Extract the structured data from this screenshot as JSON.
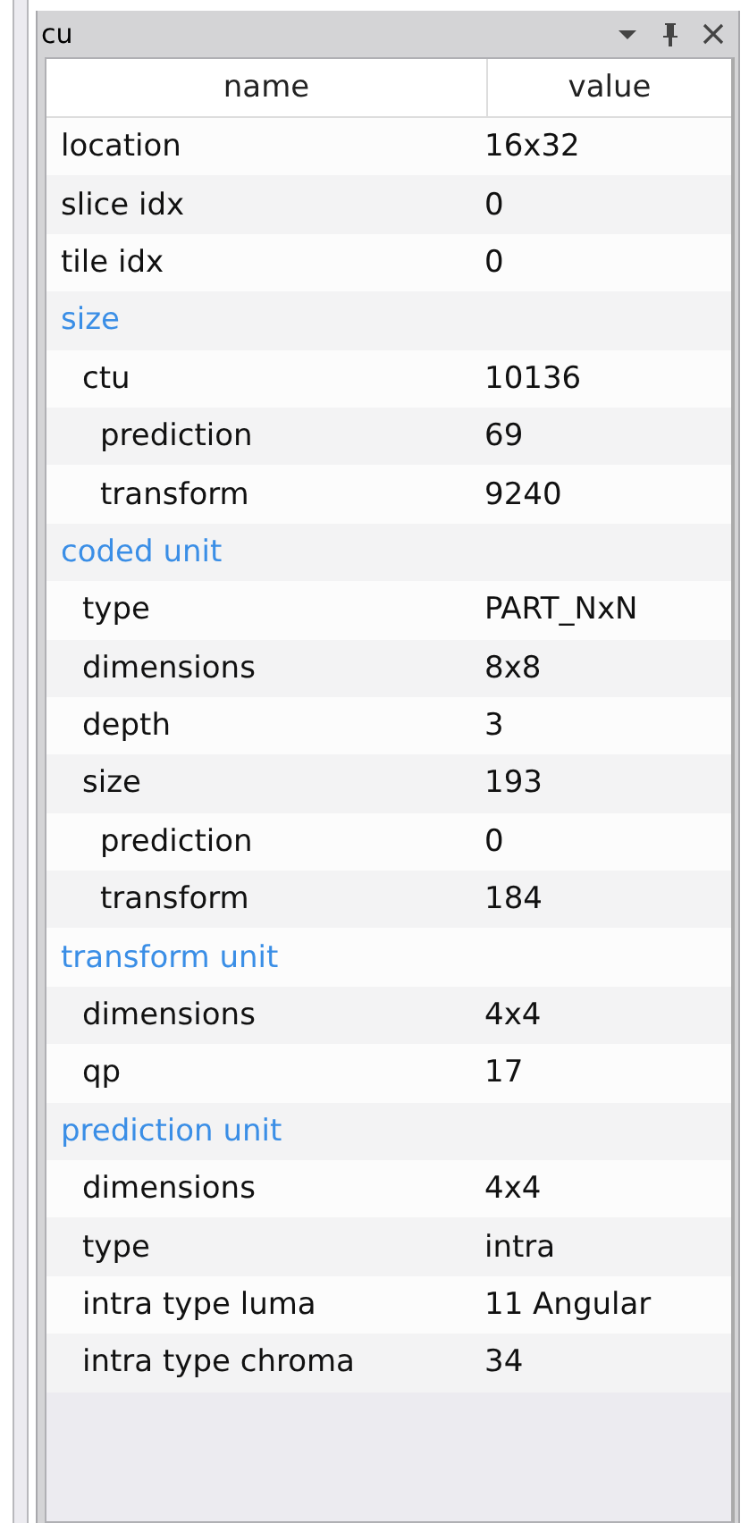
{
  "panel": {
    "title": "cu"
  },
  "columns": [
    "name",
    "value"
  ],
  "rows": [
    {
      "kind": "item",
      "name": "location",
      "value": "16x32"
    },
    {
      "kind": "item",
      "name": "slice idx",
      "value": "0"
    },
    {
      "kind": "item",
      "name": "tile idx",
      "value": "0"
    },
    {
      "kind": "group",
      "name": "size",
      "children": [
        {
          "kind": "item",
          "name": "ctu",
          "value": "10136",
          "children": [
            {
              "kind": "item",
              "name": "prediction",
              "value": "69"
            },
            {
              "kind": "item",
              "name": "transform",
              "value": "9240"
            }
          ]
        }
      ]
    },
    {
      "kind": "group",
      "name": "coded unit",
      "children": [
        {
          "kind": "item",
          "name": "type",
          "value": "PART_NxN"
        },
        {
          "kind": "item",
          "name": "dimensions",
          "value": "8x8"
        },
        {
          "kind": "item",
          "name": "depth",
          "value": "3"
        },
        {
          "kind": "item",
          "name": "size",
          "value": "193",
          "children": [
            {
              "kind": "item",
              "name": "prediction",
              "value": "0"
            },
            {
              "kind": "item",
              "name": "transform",
              "value": "184"
            }
          ]
        }
      ]
    },
    {
      "kind": "group",
      "name": "transform unit",
      "children": [
        {
          "kind": "item",
          "name": "dimensions",
          "value": "4x4"
        },
        {
          "kind": "item",
          "name": "qp",
          "value": "17"
        }
      ]
    },
    {
      "kind": "group",
      "name": "prediction unit",
      "children": [
        {
          "kind": "item",
          "name": "dimensions",
          "value": "4x4"
        },
        {
          "kind": "item",
          "name": "type",
          "value": "intra"
        },
        {
          "kind": "item",
          "name": "intra type luma",
          "value": "11 Angular"
        },
        {
          "kind": "item",
          "name": "intra type chroma",
          "value": "34"
        }
      ]
    }
  ]
}
